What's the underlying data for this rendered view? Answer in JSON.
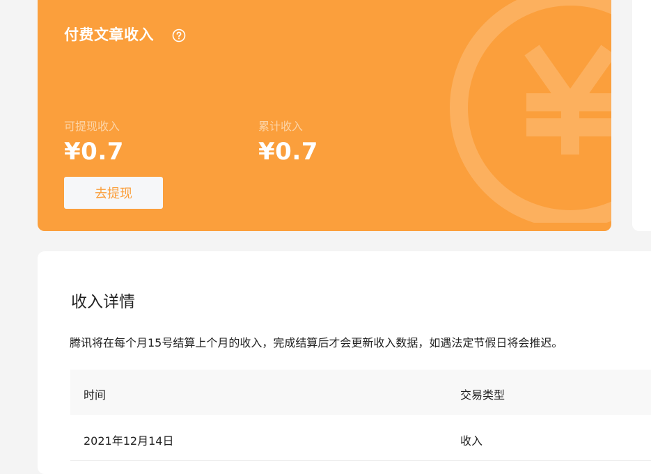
{
  "income_card": {
    "title": "付费文章收入",
    "withdrawable": {
      "label": "可提现收入",
      "value": "¥0.7"
    },
    "total": {
      "label": "累计收入",
      "value": "¥0.7"
    },
    "withdraw_button": "去提现",
    "watermark_icon": "yen-icon",
    "help_icon": "question-circle-icon"
  },
  "details": {
    "title": "收入详情",
    "notice": "腾讯将在每个月15号结算上个月的收入，完成结算后才会更新收入数据，如遇法定节假日将会推迟。",
    "columns": [
      "时间",
      "交易类型"
    ],
    "rows": [
      [
        "2021年12月14日",
        "收入"
      ]
    ]
  },
  "colors": {
    "accent": "#fb9f3c",
    "page_bg": "#f4f4f4"
  }
}
